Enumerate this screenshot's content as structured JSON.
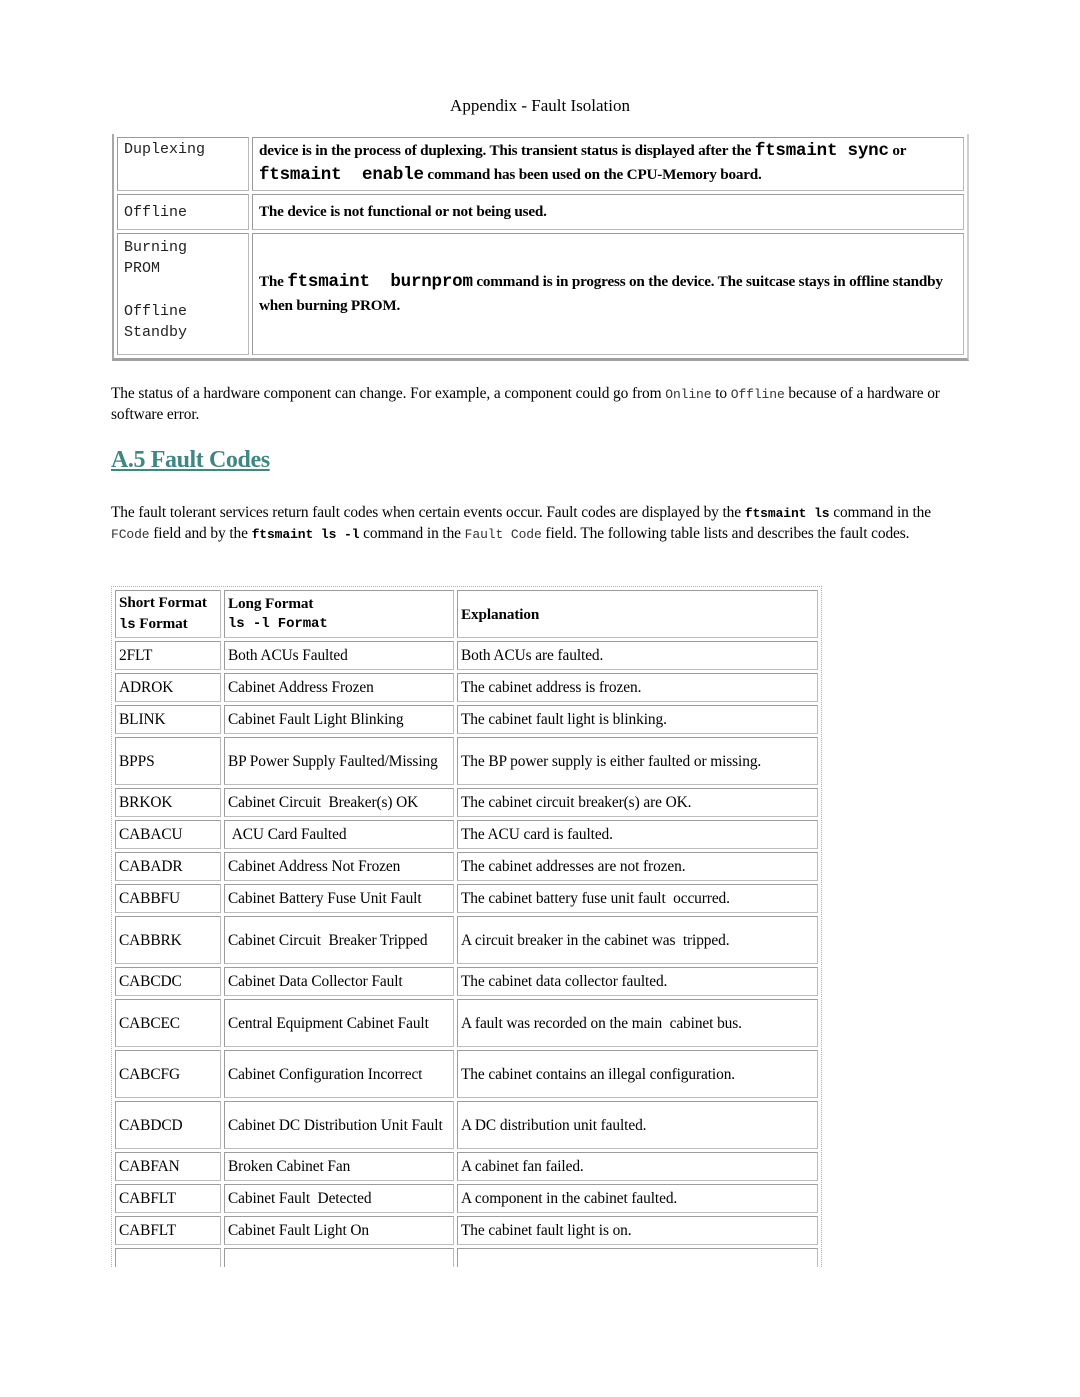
{
  "page_header": "Appendix - Fault Isolation",
  "status_table": {
    "rows": [
      {
        "status_lines": [
          "Duplexing"
        ],
        "description_parts": [
          {
            "text": "device is in the process of duplexing. This transient status is displayed after the ",
            "mono": false
          },
          {
            "text": "ftsmaint sync",
            "mono": true
          },
          {
            "text": " or ",
            "mono": false
          },
          {
            "text": "ftsmaint  enable",
            "mono": true
          },
          {
            "text": " command has been used on the CPU-Memory board.",
            "mono": false
          }
        ]
      },
      {
        "status_lines": [
          "Offline"
        ],
        "description_parts": [
          {
            "text": "The device is not functional or not being used.",
            "mono": false
          }
        ]
      },
      {
        "status_lines": [
          "Burning",
          "PROM",
          "Offline",
          "Standby"
        ],
        "description_parts": [
          {
            "text": "The ",
            "mono": false
          },
          {
            "text": "ftsmaint  burnprom",
            "mono": true
          },
          {
            "text": " command is in progress on the device. The suitcase stays in offline standby when burning PROM.",
            "mono": false
          }
        ]
      }
    ]
  },
  "paragraph_status_change": {
    "before": "The status of a hardware component can change. For example, a component could go from ",
    "code1": "Online",
    "middle": " to ",
    "code2": "Offline",
    "after": " because of a hardware or software error."
  },
  "section": {
    "heading": "A.5 Fault Codes",
    "link_color": "#3e8783"
  },
  "paragraph_fault_codes": {
    "t1": "The fault tolerant services return fault codes when certain events occur. Fault codes are displayed by the ",
    "c1": "ftsmaint ls",
    "t2": " command in the ",
    "c2": "FCode",
    "t3": " field and by the ",
    "c3": "ftsmaint ls -l",
    "t4": " command in the ",
    "c4": "Fault Code",
    "t5": " field. The following table lists and describes the fault codes."
  },
  "fault_table": {
    "headers": {
      "short_line1": "Short Format",
      "short_mono": "ls",
      "short_line2": " Format",
      "long_line1": "Long Format",
      "long_mono": "ls -l Format",
      "explanation": "Explanation"
    },
    "rows": [
      {
        "short": "2FLT",
        "long": "Both ACUs Faulted",
        "explanation": "Both ACUs are faulted."
      },
      {
        "short": "ADROK",
        "long": "Cabinet Address Frozen",
        "explanation": "The cabinet address is frozen."
      },
      {
        "short": "BLINK",
        "long": "Cabinet Fault Light Blinking",
        "explanation": "The cabinet fault light is blinking."
      },
      {
        "short": "BPPS",
        "long": "BP Power Supply Faulted/Missing",
        "explanation": "The BP power supply is either faulted or missing."
      },
      {
        "short": "BRKOK",
        "long": "Cabinet Circuit  Breaker(s) OK",
        "explanation": "The cabinet circuit breaker(s) are OK."
      },
      {
        "short": "CABACU",
        "long": " ACU Card Faulted",
        "explanation": "The ACU card is faulted."
      },
      {
        "short": "CABADR",
        "long": "Cabinet Address Not Frozen",
        "explanation": "The cabinet addresses are not frozen."
      },
      {
        "short": "CABBFU",
        "long": "Cabinet Battery Fuse Unit Fault",
        "explanation": "The cabinet battery fuse unit fault  occurred."
      },
      {
        "short": "CABBRK",
        "long": "Cabinet Circuit  Breaker Tripped",
        "explanation": "A circuit breaker in the cabinet was  tripped."
      },
      {
        "short": "CABCDC",
        "long": "Cabinet Data Collector Fault",
        "explanation": "The cabinet data collector faulted."
      },
      {
        "short": "CABCEC",
        "long": "Central Equipment Cabinet Fault",
        "explanation": "A fault was recorded on the main  cabinet bus."
      },
      {
        "short": "CABCFG",
        "long": "Cabinet Configuration Incorrect",
        "explanation": "The cabinet contains an illegal configuration."
      },
      {
        "short": "CABDCD",
        "long": "Cabinet DC Distribution Unit Fault",
        "explanation": "A DC distribution unit faulted."
      },
      {
        "short": "CABFAN",
        "long": "Broken Cabinet Fan",
        "explanation": "A cabinet fan failed."
      },
      {
        "short": "CABFLT",
        "long": "Cabinet Fault  Detected",
        "explanation": "A component in the cabinet faulted."
      },
      {
        "short": "CABFLT",
        "long": "Cabinet Fault Light On",
        "explanation": "The cabinet fault light is on."
      }
    ]
  }
}
